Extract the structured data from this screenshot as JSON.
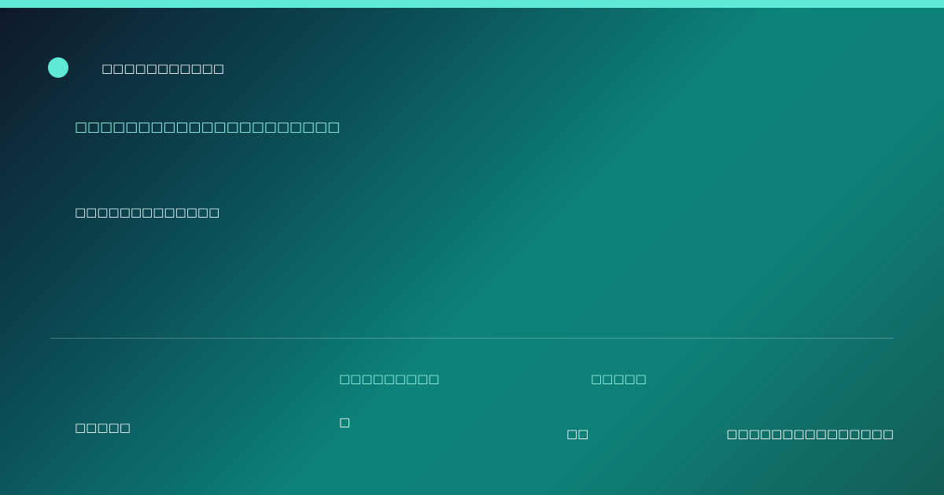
{
  "colors": {
    "accent": "#5eead4",
    "heading_text": "#99f6e4",
    "body_text": "#ffffff"
  },
  "header": {
    "brand_name": "□□□□□□□□□□□"
  },
  "hero": {
    "headline": "□□□□□□□□□□□□□□□□□□□□□",
    "subline": "□□□□□□□□□□□□□"
  },
  "footer": {
    "left_text": "□□□□□",
    "col2_heading": "□□□□□□□□□",
    "col2_value": "□",
    "col3_heading": "□□□□□",
    "col3_value": "□□",
    "right_text": "□□□□□□□□□□□□□□□"
  }
}
